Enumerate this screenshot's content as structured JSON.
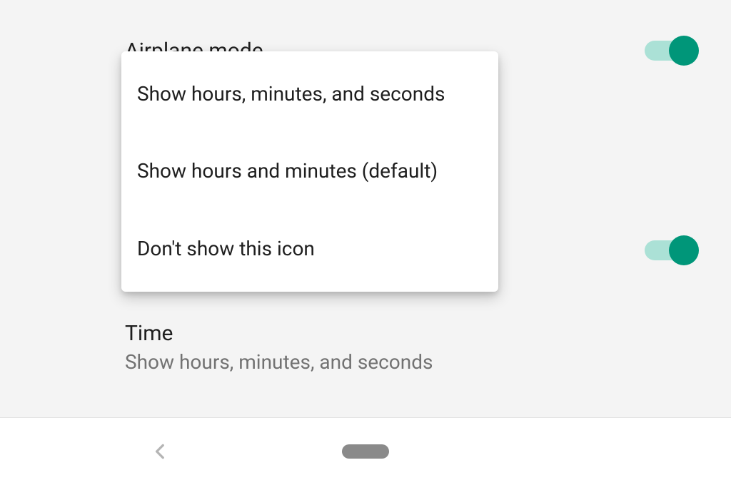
{
  "settings": {
    "airplane": {
      "title": "Airplane mode",
      "enabled": true
    },
    "middle_toggle": {
      "enabled": true
    },
    "time": {
      "title": "Time",
      "subtitle": "Show hours, minutes, and seconds"
    }
  },
  "popup": {
    "options": [
      "Show hours, minutes, and seconds",
      "Show hours and minutes (default)",
      "Don't show this icon"
    ]
  },
  "colors": {
    "accent": "#009679",
    "accent_track": "#abe1d6"
  }
}
